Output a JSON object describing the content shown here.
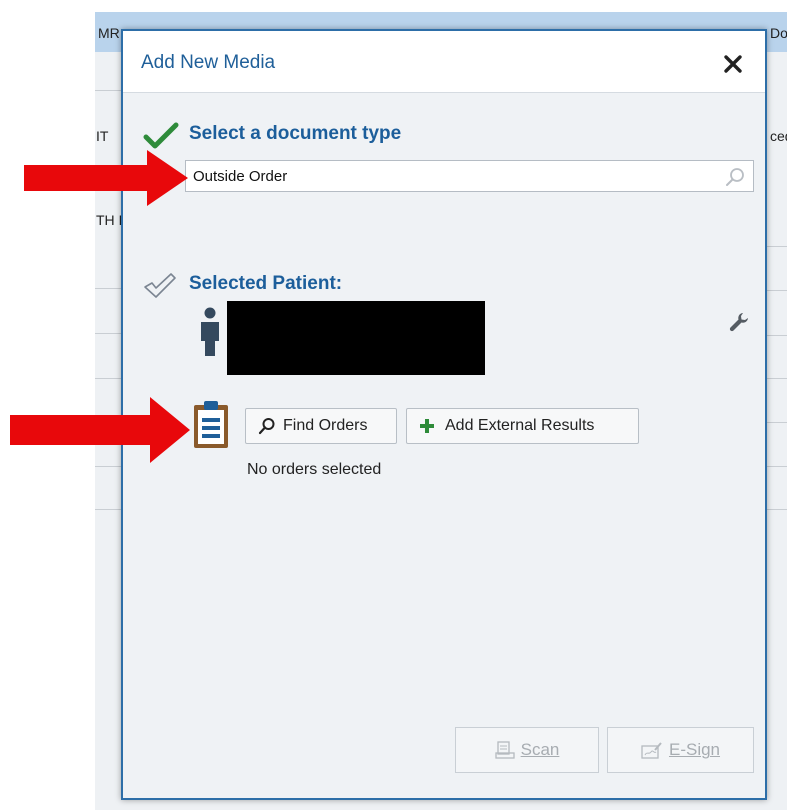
{
  "background": {
    "header_left": "MR",
    "header_right": "Do",
    "row_left_1": "IT",
    "row_left_2": "TH I",
    "row_right_1": "ced"
  },
  "dialog": {
    "title": "Add New Media",
    "close_label": "✕",
    "document_type": {
      "heading": "Select a document type",
      "value": "Outside Order"
    },
    "patient": {
      "heading": "Selected Patient:"
    },
    "orders": {
      "find_orders_label": "Find Orders",
      "add_external_label": "Add External Results",
      "status": "No orders selected"
    },
    "footer": {
      "scan_label": "Scan",
      "esign_label": "E-Sign"
    }
  },
  "colors": {
    "accent_blue": "#1c5e9b",
    "check_green": "#2e8b3a",
    "annotation_red": "#e8080b",
    "clipboard_brown": "#8a5a2b"
  },
  "icons": [
    "check-icon",
    "check-outline-icon",
    "person-icon",
    "wrench-icon",
    "search-icon",
    "clipboard-icon",
    "plus-icon",
    "scan-icon",
    "esign-icon"
  ]
}
